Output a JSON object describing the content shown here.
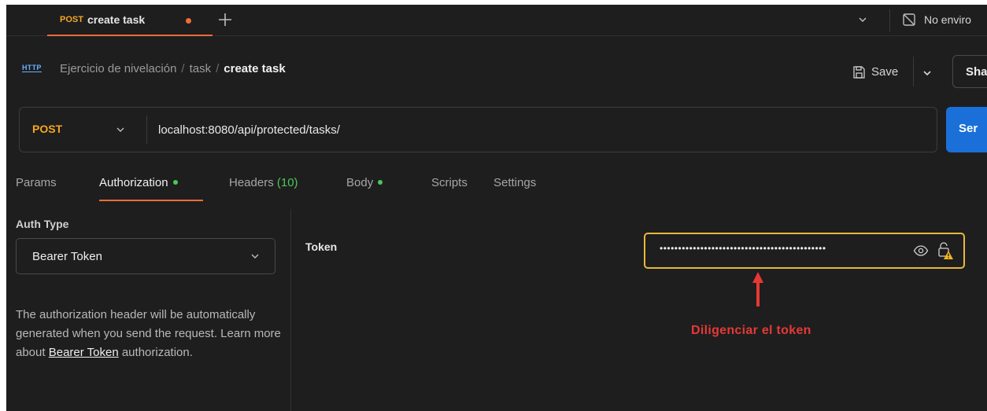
{
  "tabs": [
    {
      "method": "POST",
      "name": "create task",
      "unsaved": true
    }
  ],
  "environment": {
    "label": "No enviro"
  },
  "breadcrumb": {
    "icon": "HTTP",
    "items": [
      "Ejercicio de nivelación",
      "task"
    ],
    "current": "create task",
    "separator": "/"
  },
  "actions": {
    "save_label": "Save",
    "share_label": "Sha"
  },
  "request": {
    "method": "POST",
    "url": "localhost:8080/api/protected/tasks/",
    "send_label": "Ser"
  },
  "request_tabs": [
    {
      "label": "Params"
    },
    {
      "label": "Authorization",
      "active": true,
      "indicator": true
    },
    {
      "label": "Headers ",
      "count": "(10)"
    },
    {
      "label": "Body",
      "indicator": true
    },
    {
      "label": "Scripts"
    },
    {
      "label": "Settings"
    }
  ],
  "auth": {
    "type_label": "Auth Type",
    "type_value": "Bearer Token",
    "description": "The authorization header will be automatically generated when you send the request. Learn more about ",
    "link_text": "Bearer Token",
    "description_tail": " authorization."
  },
  "token": {
    "label": "Token",
    "masked_value": "•••••••••••••••••••••••••••••••••••••••••••••"
  },
  "annotation": {
    "text": "Diligenciar el token",
    "color": "#e53935"
  },
  "colors": {
    "accent": "#f26b3a",
    "method_post": "#f5a623",
    "send": "#1b6fd8",
    "indicator": "#4cc75a",
    "warning": "#e8b83a"
  }
}
